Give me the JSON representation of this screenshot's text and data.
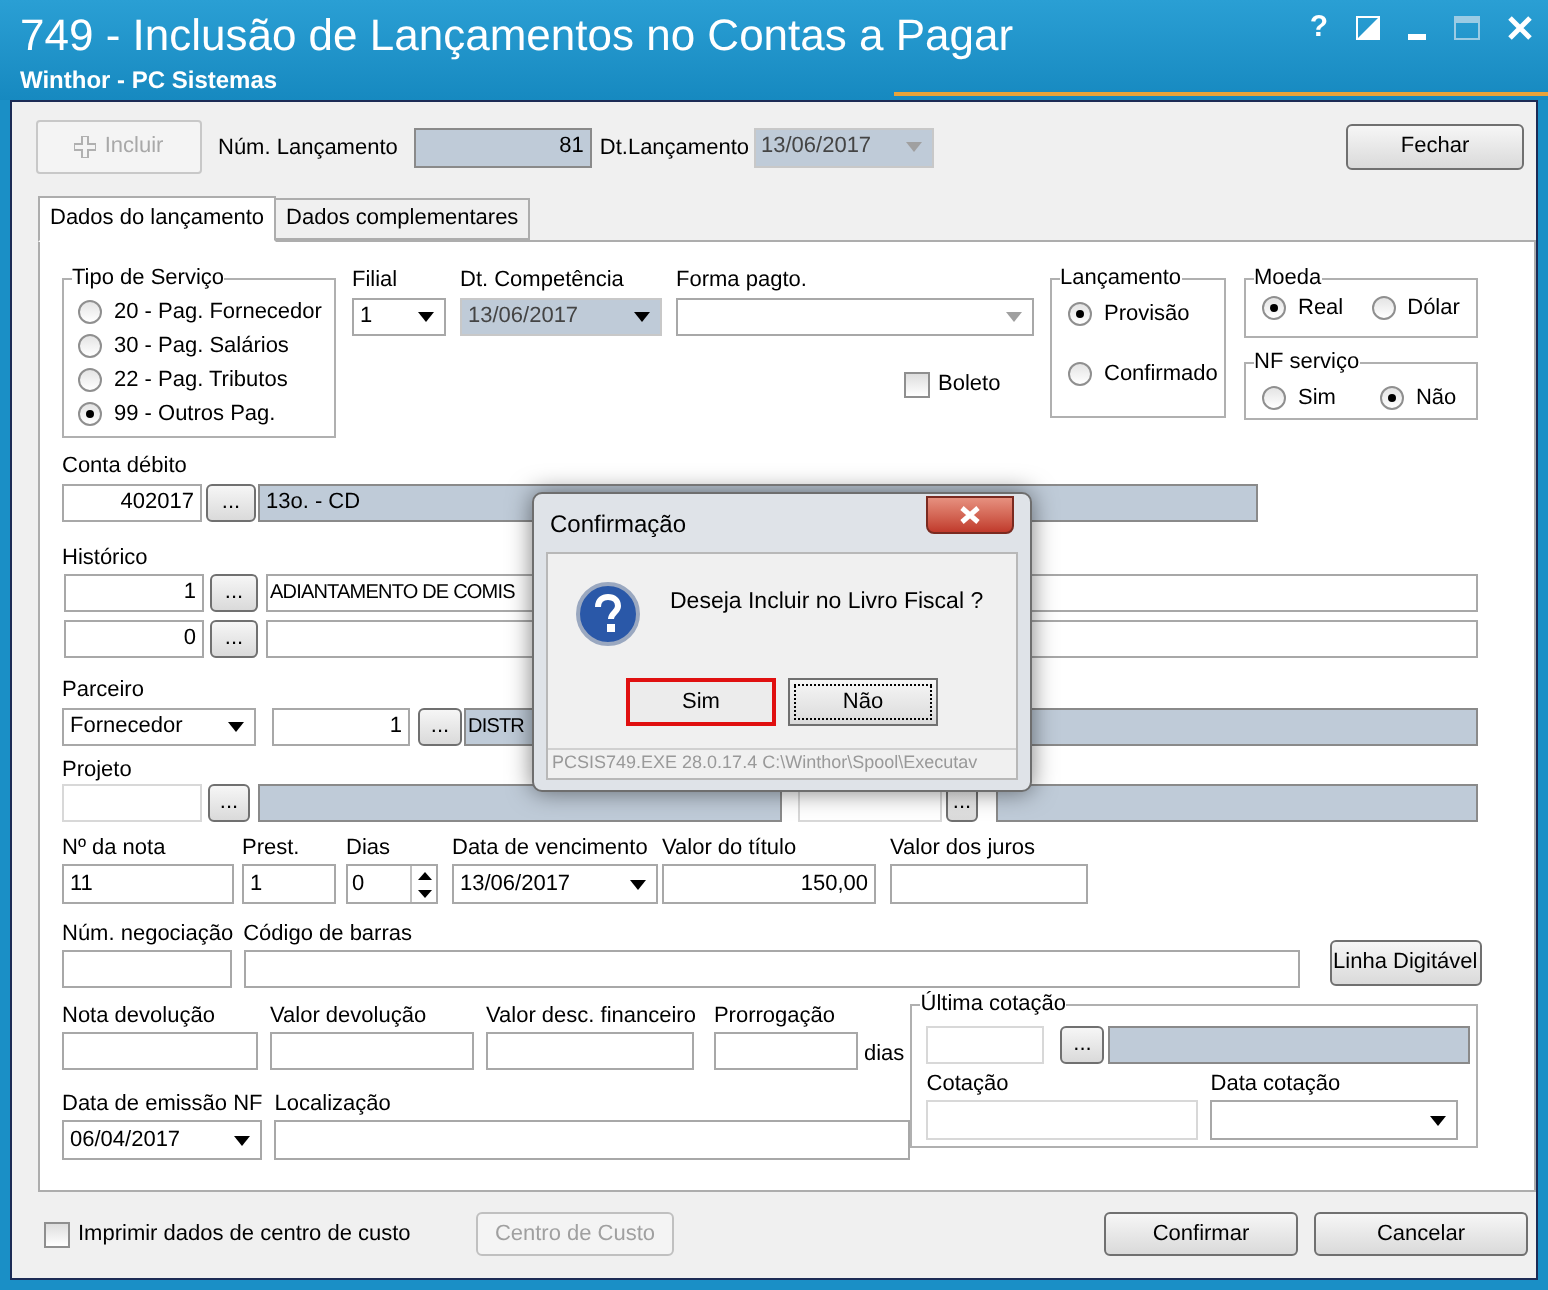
{
  "window": {
    "title": "749 - Inclusão de Lançamentos no Contas a Pagar",
    "subtitle": "Winthor - PC Sistemas",
    "help_glyph": "?"
  },
  "toolbar": {
    "incluir": {
      "label": "Incluir",
      "disabled": true
    },
    "num_lancamento": {
      "label": "Núm. Lançamento",
      "value": "81"
    },
    "dt_lancamento": {
      "label": "Dt.Lançamento",
      "value": "13/06/2017"
    },
    "fechar": "Fechar"
  },
  "tabs": [
    {
      "label": "Dados do lançamento",
      "selected": true
    },
    {
      "label": "Dados complementares",
      "selected": false
    }
  ],
  "tipo_servico": {
    "label": "Tipo de Serviço",
    "options": [
      {
        "label": "20 - Pag. Fornecedor",
        "selected": false
      },
      {
        "label": "30 - Pag. Salários",
        "selected": false
      },
      {
        "label": "22 - Pag. Tributos",
        "selected": false
      },
      {
        "label": "99 - Outros Pag.",
        "selected": true
      }
    ]
  },
  "filial": {
    "label": "Filial",
    "value": "1"
  },
  "dt_competencia": {
    "label": "Dt. Competência",
    "value": "13/06/2017",
    "disabled": true
  },
  "forma_pagto": {
    "label": "Forma pagto.",
    "disabled": true
  },
  "boleto": {
    "label": "Boleto",
    "checked": false
  },
  "lancamento": {
    "label": "Lançamento",
    "options": [
      {
        "label": "Provisão",
        "selected": true
      },
      {
        "label": "Confirmado",
        "selected": false
      }
    ]
  },
  "moeda": {
    "label": "Moeda",
    "options": [
      {
        "label": "Real",
        "selected": true
      },
      {
        "label": "Dólar",
        "selected": false
      }
    ]
  },
  "nf_servico": {
    "label": "NF serviço",
    "options": [
      {
        "label": "Sim",
        "selected": false
      },
      {
        "label": "Não",
        "selected": true
      }
    ]
  },
  "conta_debito": {
    "label": "Conta débito",
    "code": "402017",
    "button": "...",
    "description": "13o. - CD"
  },
  "historico": {
    "label": "Histórico",
    "rows": [
      {
        "code": "1",
        "button": "...",
        "text": "ADIANTAMENTO DE COMIS"
      },
      {
        "code": "0",
        "button": "..."
      }
    ]
  },
  "parceiro": {
    "label": "Parceiro",
    "type": "Fornecedor",
    "code": "1",
    "button": "...",
    "name": "DISTR"
  },
  "projeto": {
    "label": "Projeto",
    "buttons": [
      "...",
      "..."
    ]
  },
  "titulo": {
    "nota": {
      "label": "Nº da nota",
      "value": "11"
    },
    "prest": {
      "label": "Prest.",
      "value": "1"
    },
    "dias": {
      "label": "Dias",
      "value": "0"
    },
    "vencimento": {
      "label": "Data de vencimento",
      "value": "13/06/2017"
    },
    "valor": {
      "label": "Valor do título",
      "value": "150,00"
    },
    "juros": {
      "label": "Valor dos juros"
    }
  },
  "negociacao": {
    "label": "Núm. negociação"
  },
  "codigo_barras": {
    "label": "Código de barras",
    "button": "Linha Digitável"
  },
  "devolucao": {
    "nota": "Nota devolução",
    "valor": "Valor devolução",
    "desconto": "Valor desc. financeiro",
    "prorrogacao": "Prorrogação",
    "unit": "dias"
  },
  "emissao_nf": {
    "label": "Data de emissão NF",
    "value": "06/04/2017"
  },
  "localizacao": {
    "label": "Localização"
  },
  "ultima_cotacao": {
    "label": "Última cotação",
    "button": "...",
    "cotacao": "Cotação",
    "data_cotacao": "Data cotação"
  },
  "footer": {
    "imprimir": {
      "label": "Imprimir dados de centro de custo",
      "checked": false
    },
    "centro_custo": {
      "label": "Centro de Custo",
      "disabled": true
    },
    "confirmar": "Confirmar",
    "cancelar": "Cancelar"
  },
  "dialog": {
    "title": "Confirmação",
    "message": "Deseja Incluir no Livro Fiscal ?",
    "buttons": [
      {
        "label": "Sim",
        "highlighted": true,
        "focused": false
      },
      {
        "label": "Não",
        "highlighted": false,
        "focused": true
      }
    ],
    "status": "PCSIS749.EXE 28.0.17.4 C:\\Winthor\\Spool\\Executav"
  }
}
